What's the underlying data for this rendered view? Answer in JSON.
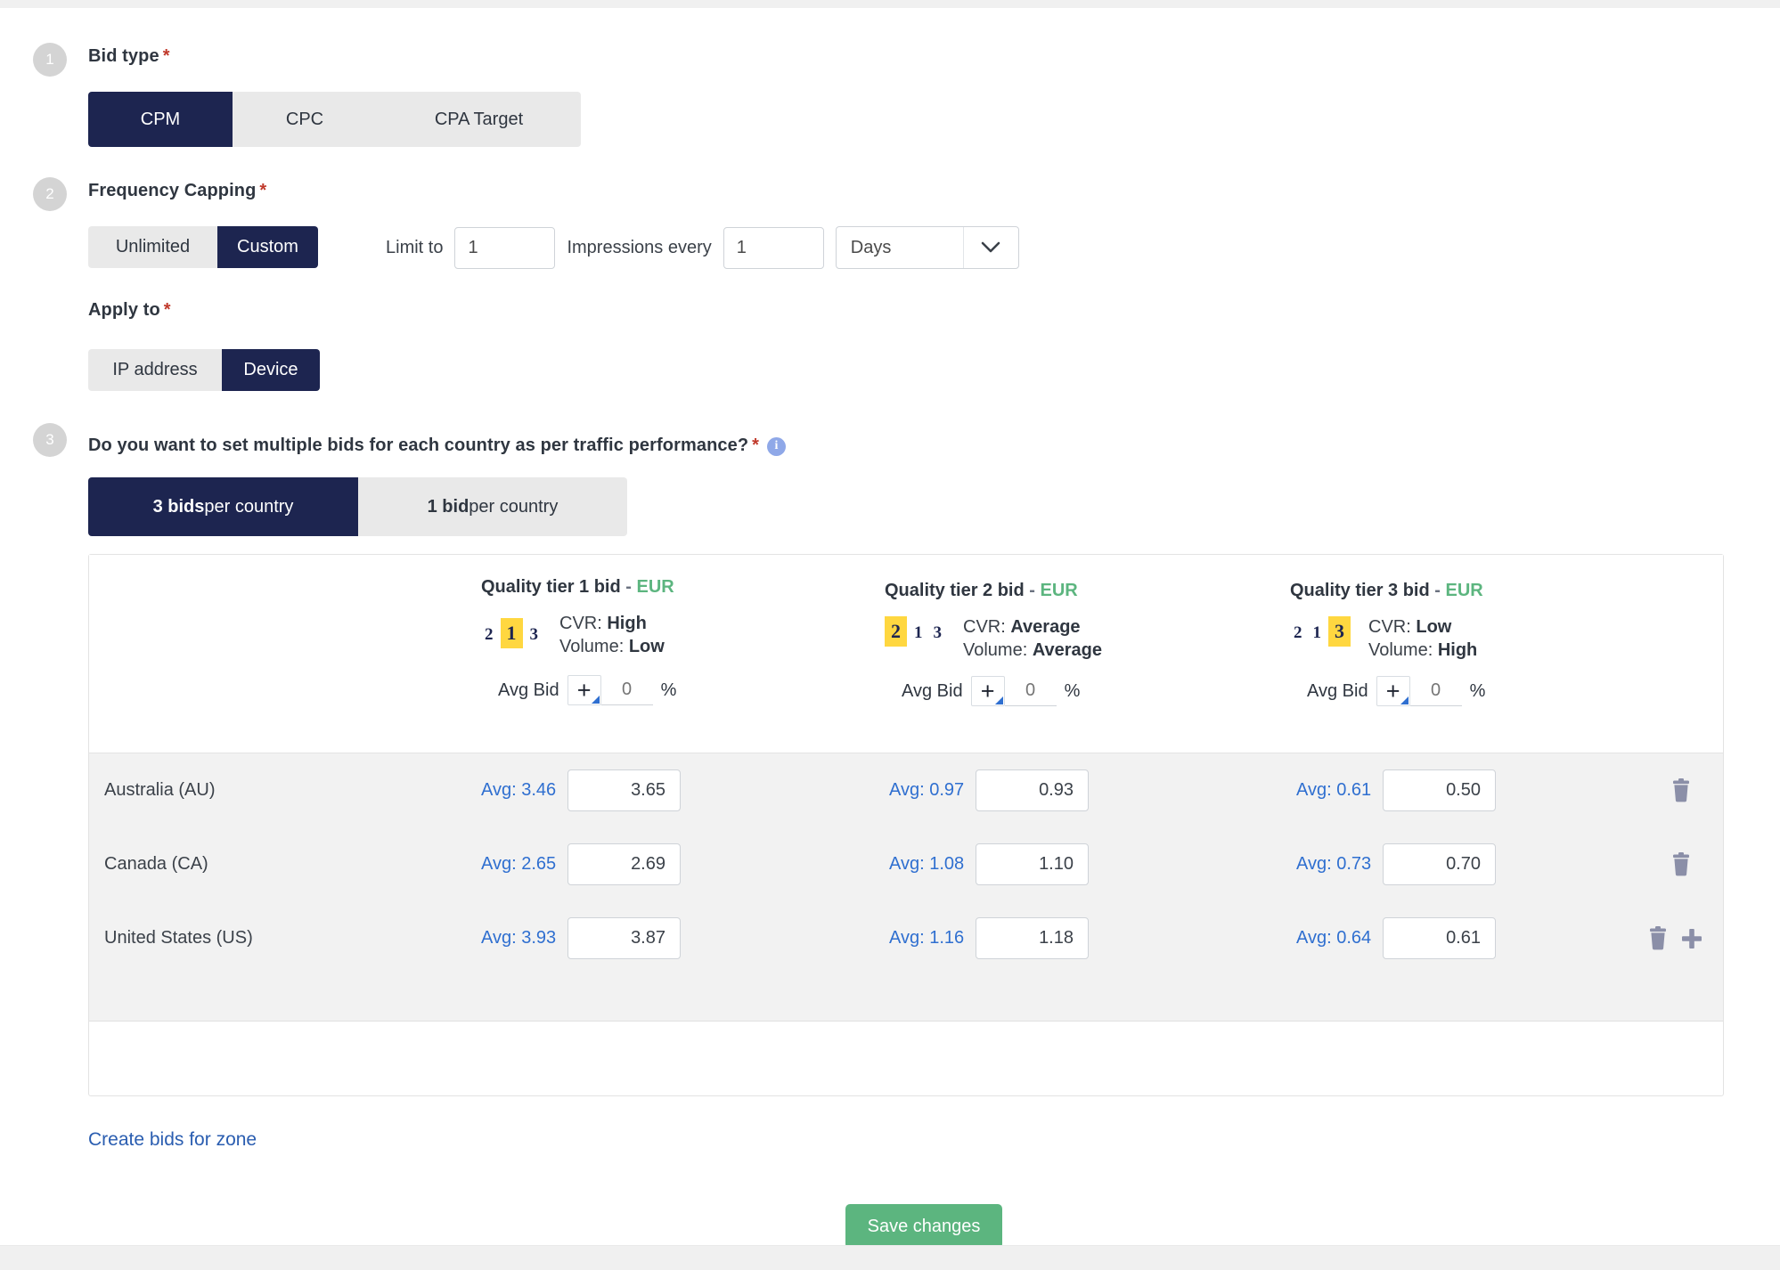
{
  "steps": {
    "one": "1",
    "two": "2",
    "three": "3"
  },
  "bid_type": {
    "label": "Bid type",
    "required_mark": "*",
    "options": [
      {
        "label": "CPM",
        "active": true
      },
      {
        "label": "CPC",
        "active": false
      },
      {
        "label": "CPA Target",
        "active": false
      }
    ]
  },
  "frequency_capping": {
    "label": "Frequency Capping",
    "required_mark": "*",
    "options": [
      {
        "label": "Unlimited",
        "active": false
      },
      {
        "label": "Custom",
        "active": true
      }
    ],
    "limit_to_label": "Limit to",
    "limit_value": "1",
    "impressions_label": "Impressions every",
    "period_value": "1",
    "unit_selected": "Days",
    "unit_icon": "chevron-down-icon"
  },
  "apply_to": {
    "label": "Apply to",
    "required_mark": "*",
    "options": [
      {
        "label": "IP address",
        "active": false
      },
      {
        "label": "Device",
        "active": true
      }
    ]
  },
  "multi_bids": {
    "question": "Do you want to set multiple bids for each country as per traffic performance?",
    "required_mark": "*",
    "info_icon": "info-icon",
    "info_glyph": "i",
    "options": [
      {
        "bold": "3 bids",
        "rest": " per country",
        "active": true
      },
      {
        "bold": "1 bid",
        "rest": " per country",
        "active": false
      }
    ]
  },
  "bids_table": {
    "tiers": [
      {
        "title": "Quality tier 1 bid",
        "dash": "-",
        "currency": "EUR",
        "rank": [
          "2",
          "1",
          "3"
        ],
        "highlight": "1",
        "cvr_label": "CVR:",
        "cvr_value": "High",
        "volume_label": "Volume:",
        "volume_value": "Low",
        "avg_bid_label": "Avg Bid",
        "plus_icon": "plus-icon",
        "pct_placeholder": "0",
        "pct_sign": "%"
      },
      {
        "title": "Quality tier 2 bid",
        "dash": "-",
        "currency": "EUR",
        "rank": [
          "2",
          "1",
          "3"
        ],
        "highlight": "2",
        "cvr_label": "CVR:",
        "cvr_value": "Average",
        "volume_label": "Volume:",
        "volume_value": "Average",
        "avg_bid_label": "Avg Bid",
        "plus_icon": "plus-icon",
        "pct_placeholder": "0",
        "pct_sign": "%"
      },
      {
        "title": "Quality tier 3 bid",
        "dash": "-",
        "currency": "EUR",
        "rank": [
          "2",
          "1",
          "3"
        ],
        "highlight": "3",
        "cvr_label": "CVR:",
        "cvr_value": "Low",
        "volume_label": "Volume:",
        "volume_value": "High",
        "avg_bid_label": "Avg Bid",
        "plus_icon": "plus-icon",
        "pct_placeholder": "0",
        "pct_sign": "%"
      }
    ],
    "rows": [
      {
        "country": "Australia (AU)",
        "cells": [
          {
            "avg": "Avg: 3.46",
            "bid": "3.65"
          },
          {
            "avg": "Avg: 0.97",
            "bid": "0.93"
          },
          {
            "avg": "Avg: 0.61",
            "bid": "0.50"
          }
        ],
        "delete_icon": "trash-icon",
        "has_add": false
      },
      {
        "country": "Canada (CA)",
        "cells": [
          {
            "avg": "Avg: 2.65",
            "bid": "2.69"
          },
          {
            "avg": "Avg: 1.08",
            "bid": "1.10"
          },
          {
            "avg": "Avg: 0.73",
            "bid": "0.70"
          }
        ],
        "delete_icon": "trash-icon",
        "has_add": false
      },
      {
        "country": "United States (US)",
        "cells": [
          {
            "avg": "Avg: 3.93",
            "bid": "3.87"
          },
          {
            "avg": "Avg: 1.16",
            "bid": "1.18"
          },
          {
            "avg": "Avg: 0.64",
            "bid": "0.61"
          }
        ],
        "delete_icon": "trash-icon",
        "add_icon": "plus-icon",
        "has_add": true
      }
    ]
  },
  "create_bids_link": "Create bids for zone",
  "save_button": "Save changes",
  "colors": {
    "navy": "#1d2550",
    "green": "#5cb57f",
    "blue_link": "#2a5db0",
    "avg_blue": "#2f6fd0",
    "highlight_yellow": "#ffd740",
    "required_red": "#c0392b",
    "info_blue": "#8fa8e8"
  }
}
